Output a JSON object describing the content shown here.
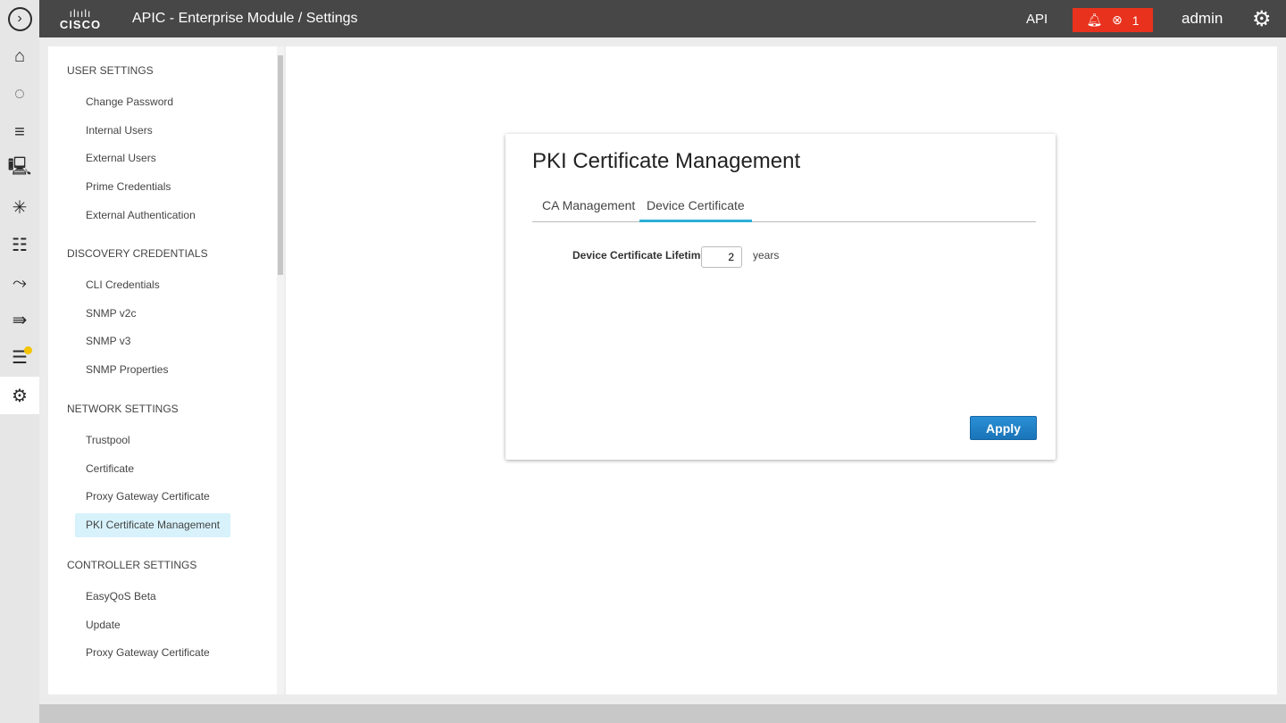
{
  "header": {
    "logo_bars": "ılıılı",
    "logo_text": "CISCO",
    "title": "APIC - Enterprise Module / Settings",
    "api_label": "API",
    "alert_count": "1",
    "user": "admin"
  },
  "rail": {
    "icons": [
      "expand-icon",
      "home-icon",
      "discovery-icon",
      "inventory-icon",
      "device-icon",
      "topology-icon",
      "hierarchy-icon",
      "path-trace-icon",
      "forward-icon",
      "policy-icon",
      "settings-icon"
    ]
  },
  "sidebar": {
    "sections": [
      {
        "title": "USER SETTINGS",
        "items": [
          "Change Password",
          "Internal Users",
          "External Users",
          "Prime Credentials",
          "External Authentication"
        ]
      },
      {
        "title": "DISCOVERY CREDENTIALS",
        "items": [
          "CLI Credentials",
          "SNMP v2c",
          "SNMP v3",
          "SNMP Properties"
        ]
      },
      {
        "title": "NETWORK SETTINGS",
        "items": [
          "Trustpool",
          "Certificate",
          "Proxy Gateway Certificate",
          "PKI Certificate Management"
        ]
      },
      {
        "title": "CONTROLLER SETTINGS",
        "items": [
          "EasyQoS Beta",
          "Update",
          "Proxy Gateway Certificate"
        ]
      }
    ],
    "selected": "PKI Certificate Management"
  },
  "card": {
    "title": "PKI Certificate Management",
    "tabs": [
      "CA Management",
      "Device Certificate"
    ],
    "active_tab": "Device Certificate",
    "lifetime_label": "Device Certificate Lifetime",
    "lifetime_value": "2",
    "lifetime_unit": "years",
    "apply_label": "Apply"
  },
  "colors": {
    "header": "#474747",
    "alert": "#e8321d",
    "accent": "#2bb0d8",
    "button": "#1a74b8",
    "selected": "#d7f2fb"
  }
}
